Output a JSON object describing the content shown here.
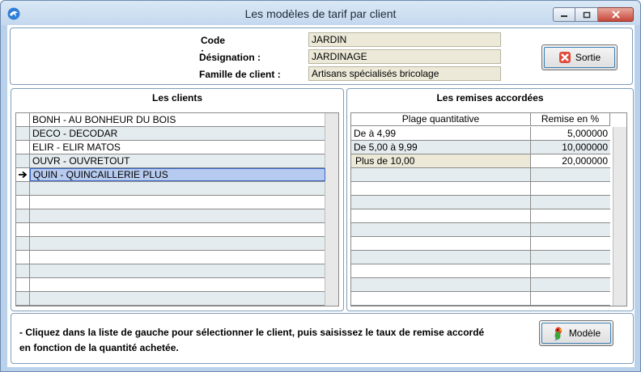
{
  "window": {
    "title": "Les modèles de tarif par client",
    "controls": [
      "minimize",
      "maximize",
      "close"
    ]
  },
  "header": {
    "code_label": "Code :",
    "code_value": "JARDIN",
    "designation_label": "Désignation :",
    "designation_value": "JARDINAGE",
    "famille_label": "Famille de client :",
    "famille_value": "Artisans spécialisés bricolage",
    "sortie_label": "Sortie"
  },
  "clients": {
    "title": "Les clients",
    "items": [
      "BONH - AU BONHEUR DU BOIS",
      "DECO - DECODAR",
      "ELIR - ELIR MATOS",
      "OUVR - OUVRETOUT",
      "QUIN - QUINCAILLERIE PLUS"
    ],
    "selected_index": 4,
    "row_count": 14
  },
  "remises": {
    "title": "Les remises accordées",
    "columns": [
      "Plage quantitative",
      "Remise en %"
    ],
    "rows": [
      {
        "plage": "De  à 4,99",
        "remise": "5,000000"
      },
      {
        "plage": "De 5,00 à 9,99",
        "remise": "10,000000"
      },
      {
        "plage": "Plus de 10,00",
        "remise": "20,000000"
      }
    ],
    "row_count": 13
  },
  "footer": {
    "note_line1": "- Cliquez dans la liste de gauche pour sélectionner le client, puis saisissez le taux de remise accordé",
    "note_line2": "en fonction de la quantité achetée.",
    "modele_label": "Modèle"
  },
  "colors": {
    "frame": "#b9d1ea",
    "selection": "#b7cbf0",
    "alt_row": "#e5ecef",
    "readonly_field": "#ece9d8"
  }
}
